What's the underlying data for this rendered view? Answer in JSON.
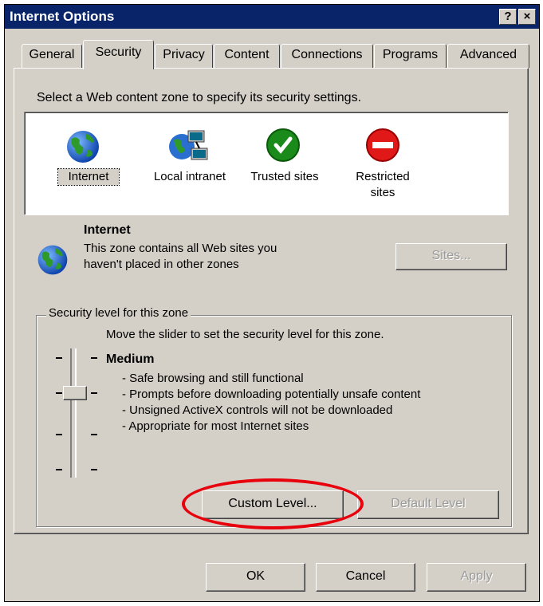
{
  "window": {
    "title": "Internet Options",
    "help_glyph": "?",
    "close_glyph": "×"
  },
  "tabs": [
    {
      "label": "General",
      "active": false
    },
    {
      "label": "Security",
      "active": true
    },
    {
      "label": "Privacy",
      "active": false
    },
    {
      "label": "Content",
      "active": false
    },
    {
      "label": "Connections",
      "active": false
    },
    {
      "label": "Programs",
      "active": false
    },
    {
      "label": "Advanced",
      "active": false
    }
  ],
  "security": {
    "instruction": "Select a Web content zone to specify its security settings.",
    "zones": [
      {
        "label": "Internet",
        "icon": "globe-icon",
        "selected": true
      },
      {
        "label": "Local intranet",
        "icon": "network-computer-icon",
        "selected": false
      },
      {
        "label": "Trusted sites",
        "icon": "green-checkmark-icon",
        "selected": false
      },
      {
        "label_line1": "Restricted",
        "label_line2": "sites",
        "icon": "red-no-entry-icon",
        "selected": false
      }
    ],
    "selected_zone": {
      "name": "Internet",
      "description_line1": "This zone contains all Web sites you",
      "description_line2": "haven't placed in other zones",
      "sites_button": "Sites..."
    },
    "level_group": {
      "legend": "Security level for this zone",
      "instruction": "Move the slider to set the security level for this zone.",
      "level_name": "Medium",
      "details": [
        "- Safe browsing and still functional",
        "- Prompts before downloading potentially unsafe content",
        "- Unsigned ActiveX controls will not be downloaded",
        "- Appropriate for most Internet sites"
      ],
      "custom_level_button": "Custom Level...",
      "default_level_button": "Default Level"
    }
  },
  "footer": {
    "ok": "OK",
    "cancel": "Cancel",
    "apply": "Apply"
  },
  "colors": {
    "titlebar": "#0a246a",
    "face": "#d4d0c8",
    "highlight_oval": "#e8000c"
  }
}
